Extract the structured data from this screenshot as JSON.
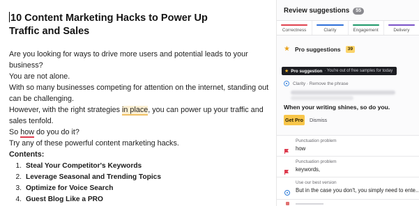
{
  "editor": {
    "title": "10 Content Marketing Hacks to Power Up Traffic and Sales",
    "body": {
      "p1": "Are you looking for ways to drive more users and potential leads to your business?",
      "p2": "You are not alone.",
      "p3": "With so many businesses competing for attention on the internet, standing out can be challenging.",
      "p4_before": "However, with the right strategies ",
      "p4_mark": "in place",
      "p4_after": ", you can power up your traffic and sales tenfold.",
      "p5_before": "So ",
      "p5_mark": "how",
      "p5_after": " do you do it?",
      "p6": "Try any of these powerful content marketing hacks.",
      "contents_label": "Contents:"
    },
    "toc": [
      {
        "num": "1.",
        "text": "Steal Your Competitor's Keywords"
      },
      {
        "num": "2.",
        "text": "Leverage Seasonal and Trending Topics"
      },
      {
        "num": "3.",
        "text": "Optimize for Voice Search"
      },
      {
        "num": "4.",
        "text": "Guest Blog Like a PRO"
      }
    ]
  },
  "panel": {
    "title": "Review suggestions",
    "count": "55",
    "categories": [
      {
        "label": "Correctness",
        "color": "#e0424f",
        "fill": 1.0
      },
      {
        "label": "Clarity",
        "color": "#2e6fd9",
        "fill": 1.0
      },
      {
        "label": "Engagement",
        "color": "#1f9a6b",
        "fill": 1.0
      },
      {
        "label": "Delivery",
        "color": "#7a53c8",
        "fill": 1.0
      }
    ],
    "pro": {
      "label": "Pro suggestions",
      "count": "39"
    },
    "tooltip": {
      "bold": "Pro suggestion",
      "text": "· You're out of free samples for today"
    },
    "clarity_meta": "Clarity · Remove the phrase",
    "shine_text": "When your writing shines, so do you.",
    "get_pro": "Get Pro",
    "dismiss": "Dismiss",
    "cards": [
      {
        "type": "Punctuation problem",
        "text": "how",
        "icon": "flag-icon"
      },
      {
        "type": "Punctuation problem",
        "text": "keywords,",
        "icon": "flag-icon"
      },
      {
        "type": "Use our best version",
        "text": "But in the case you don't, you simply need to ente...",
        "icon": "globe-icon"
      }
    ],
    "colors": {
      "accent": "#f8c64a",
      "punct": "#dd3b4e",
      "clarity": "#2d7bd8"
    }
  }
}
